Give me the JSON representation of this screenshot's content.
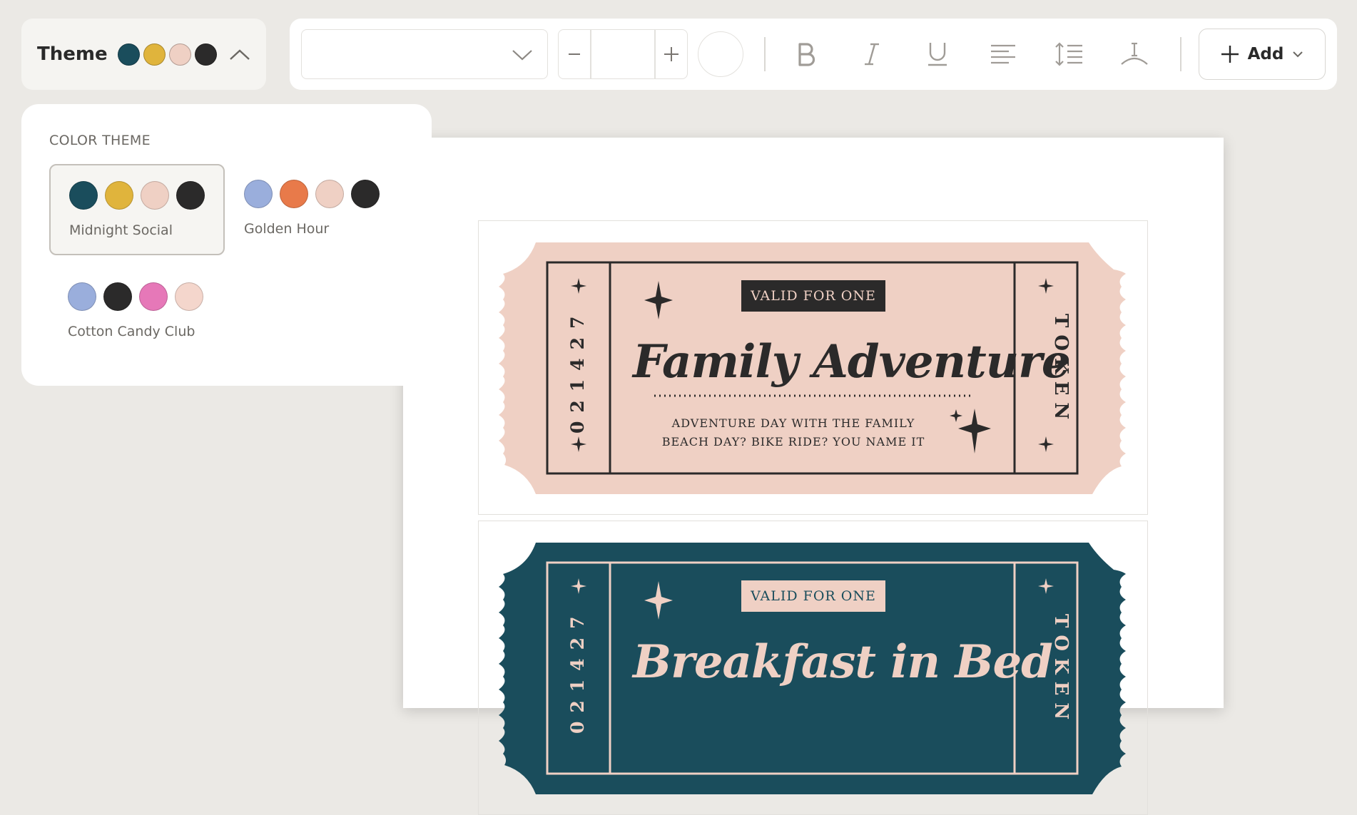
{
  "theme_bar": {
    "label": "Theme",
    "colors": [
      "#1a4d5c",
      "#e0b43c",
      "#efd0c4",
      "#2b2a2a"
    ]
  },
  "toolbar": {
    "font_select_value": "",
    "font_size_value": "",
    "add_label": "Add"
  },
  "theme_panel": {
    "title": "COLOR THEME",
    "options": [
      {
        "name": "Midnight Social",
        "colors": [
          "#1a4d5c",
          "#e0b43c",
          "#efd0c4",
          "#2b2a2a"
        ],
        "selected": true
      },
      {
        "name": "Golden Hour",
        "colors": [
          "#9aaedc",
          "#e87a4a",
          "#efd0c4",
          "#2b2a2a"
        ],
        "selected": false
      },
      {
        "name": "Cotton Candy Club",
        "colors": [
          "#9aaedc",
          "#2b2a2a",
          "#e678b8",
          "#f4d6cc"
        ],
        "selected": false
      }
    ]
  },
  "tickets": [
    {
      "badge": "VALID FOR ONE",
      "title": "Family Adventure",
      "subtitle_line1": "ADVENTURE DAY WITH THE FAMILY",
      "subtitle_line2": "BEACH DAY? BIKE RIDE? YOU NAME IT",
      "serial": "021427",
      "side_text": "TOKEN",
      "bg": "#efd0c4",
      "ink": "#2b2a2a"
    },
    {
      "badge": "VALID FOR ONE",
      "title": "Breakfast in Bed",
      "serial": "021427",
      "side_text": "TOKEN",
      "bg": "#1a4d5c",
      "ink": "#efd0c4"
    }
  ]
}
